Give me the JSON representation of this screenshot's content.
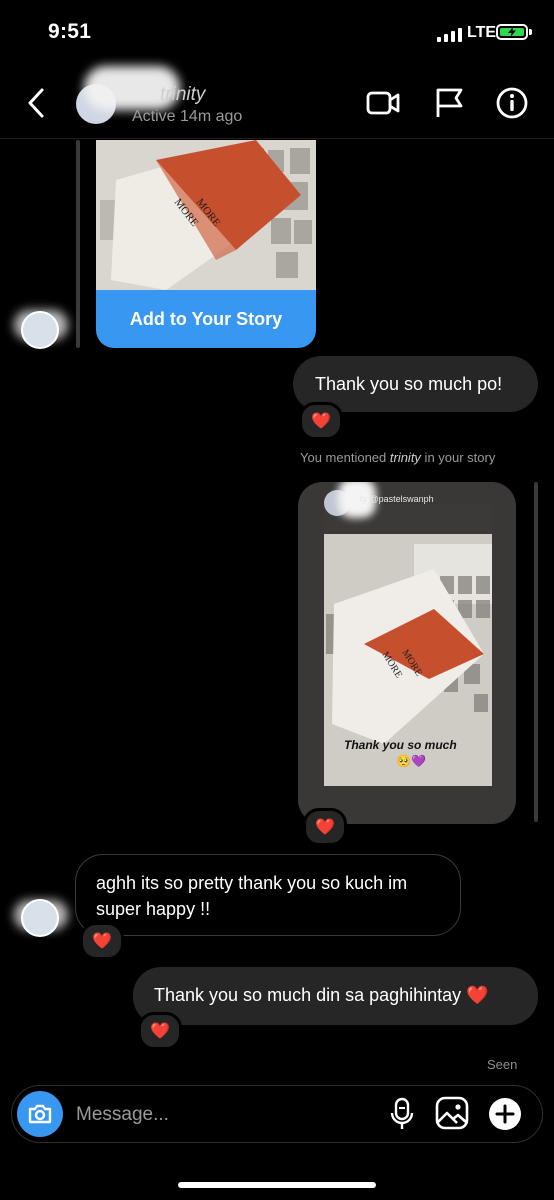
{
  "status_bar": {
    "time": "9:51",
    "network": "LTE",
    "battery_state": "charging",
    "battery_color": "#32d74b"
  },
  "header": {
    "contact_name": "trinity",
    "contact_status": "Active 14m ago",
    "back_icon": "chevron-left-icon",
    "video_icon": "video-camera-icon",
    "report_icon": "flag-icon",
    "info_icon": "info-icon"
  },
  "thread": {
    "add_story_label": "Add to Your Story",
    "message_1": "Thank you so much po!",
    "reaction_1": "❤️",
    "mention_prefix": "You mentioned ",
    "mention_name": "trinity",
    "mention_suffix": " in your story",
    "story_card_handle": "ty @pastelswanph",
    "story_caption": "Thank you so much",
    "story_caption_emoji": "🥺💜",
    "reaction_2": "❤️",
    "message_2": "aghh its so pretty thank you so kuch im super happy !!",
    "reaction_3": "❤️",
    "message_3": "Thank you so much din sa paghihintay ❤️",
    "reaction_4": "❤️",
    "seen_label": "Seen"
  },
  "composer": {
    "placeholder": "Message...",
    "camera_icon": "camera-icon",
    "mic_icon": "microphone-icon",
    "gallery_icon": "image-icon",
    "add_icon": "plus-circle-icon"
  },
  "colors": {
    "accent": "#3897f0",
    "bubble_out": "#262626",
    "background": "#000000"
  }
}
